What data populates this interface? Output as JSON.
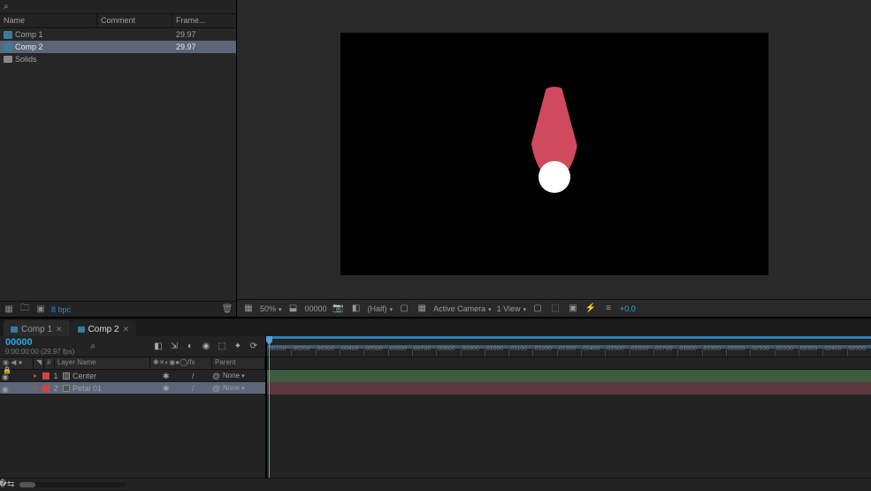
{
  "project": {
    "search_placeholder": "⌕",
    "columns": {
      "name": "Name",
      "comment": "Comment",
      "frame": "Frame..."
    },
    "items": [
      {
        "icon": "comp",
        "name": "Comp 1",
        "frame": "29.97",
        "selected": false
      },
      {
        "icon": "comp",
        "name": "Comp 2",
        "frame": "29.97",
        "selected": true
      },
      {
        "icon": "folder",
        "name": "Solids",
        "frame": "",
        "selected": false
      }
    ],
    "footer_bpc": "8 bpc"
  },
  "viewer": {
    "zoom": "50%",
    "frame": "00000",
    "resolution": "(Half)",
    "camera": "Active Camera",
    "view": "1 View",
    "exposure": "+0.0"
  },
  "timeline": {
    "tabs": [
      {
        "label": "Comp 1",
        "active": false
      },
      {
        "label": "Comp 2",
        "active": true
      }
    ],
    "timecode": "00000",
    "timecode_sub": "0:00:00:00 (29.97 fps)",
    "col": {
      "layer_name": "Layer Name",
      "parent": "Parent"
    },
    "layers": [
      {
        "index": "1",
        "name": "Center",
        "parent": "None",
        "selected": false
      },
      {
        "index": "2",
        "name": "Petal 01",
        "parent": "None",
        "selected": true
      }
    ],
    "ruler_marks": [
      "00100",
      "00200",
      "00300",
      "00400",
      "00500",
      "00600",
      "00700",
      "00800",
      "00900",
      "01000",
      "01100",
      "01200",
      "01300",
      "01400",
      "01500",
      "01600",
      "01700",
      "01800",
      "01900",
      "02000",
      "02100",
      "02200",
      "02300",
      "02400",
      "02500"
    ]
  }
}
